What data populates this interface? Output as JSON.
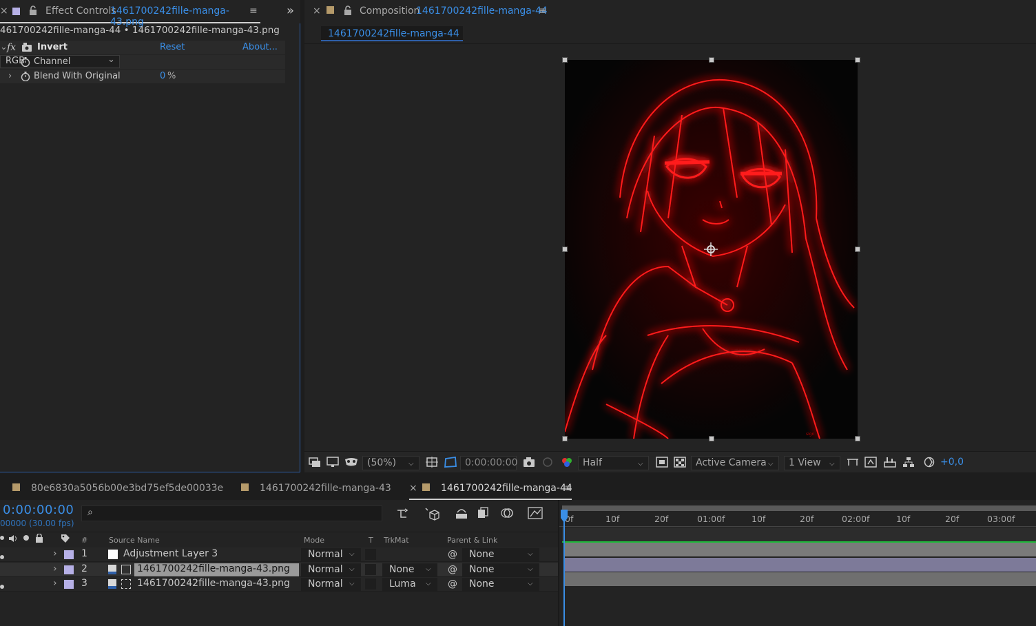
{
  "effect_controls": {
    "tab_close": "×",
    "tab_prefix": "Effect Controls",
    "tab_layer": "1461700242fille-manga-43.png",
    "subtitle": "461700242fille-manga-44 • 1461700242fille-manga-43.png",
    "effect_name": "Invert",
    "fx_label": "fx",
    "reset_label": "Reset",
    "about_label": "About...",
    "props": [
      {
        "name": "Channel",
        "value": "RGB"
      },
      {
        "name": "Blend With Original",
        "value": "0",
        "unit": "%"
      }
    ]
  },
  "composition": {
    "tab_close": "×",
    "tab_prefix": "Composition",
    "tab_name": "1461700242fille-manga-44",
    "view_tab": "1461700242fille-manga-44",
    "toolbar": {
      "zoom": "(50%)",
      "timecode": "0:00:00:00",
      "resolution": "Half",
      "camera": "Active Camera",
      "views": "1 View",
      "exposure": "+0,0"
    }
  },
  "timeline": {
    "tabs": [
      {
        "label": "80e6830a5056b00e3bd75ef5de00033e",
        "swatch": "#b59a6a"
      },
      {
        "label": "1461700242fille-manga-43",
        "swatch": "#b59a6a"
      },
      {
        "label": "1461700242fille-manga-44",
        "swatch": "#b59a6a",
        "active": true
      }
    ],
    "active_tab_close": "×",
    "timecode": "0:00:00:00",
    "fps": "00000 (30.00 fps)",
    "columns": {
      "number": "#",
      "source": "Source Name",
      "mode": "Mode",
      "t": "T",
      "trkmat": "TrkMat",
      "parent": "Parent & Link"
    },
    "layers": [
      {
        "num": "1",
        "name": "Adjustment Layer 3",
        "mode": "Normal",
        "trkmat": "",
        "parent": "None"
      },
      {
        "num": "2",
        "name": "1461700242fille-manga-43.png",
        "mode": "Normal",
        "trkmat": "None",
        "parent": "None"
      },
      {
        "num": "3",
        "name": "1461700242fille-manga-43.png",
        "mode": "Normal",
        "trkmat": "Luma",
        "parent": "None"
      }
    ],
    "ruler": [
      "0f",
      "10f",
      "20f",
      "01:00f",
      "10f",
      "20f",
      "02:00f",
      "10f",
      "20f",
      "03:00f"
    ]
  },
  "colors": {
    "accent": "#3a8ee6",
    "layer_label": "#b6b0e6",
    "glow": "#ff1a1a"
  }
}
